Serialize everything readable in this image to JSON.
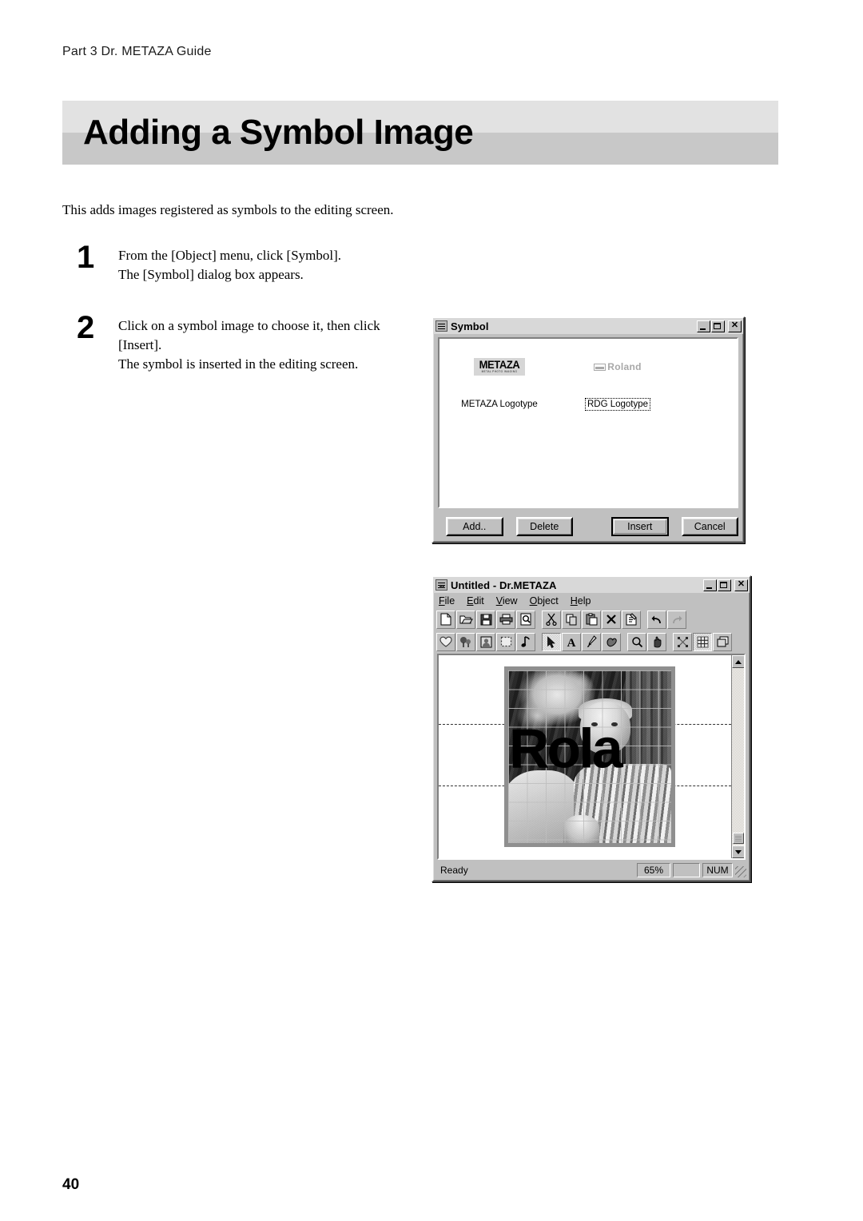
{
  "page": {
    "running_header": "Part 3  Dr. METAZA Guide",
    "title": "Adding a Symbol Image",
    "intro": "This adds images registered as symbols to the editing screen.",
    "page_number": "40"
  },
  "steps": [
    {
      "number": "1",
      "lines": [
        "From the [Object] menu, click [Symbol].",
        "The [Symbol] dialog box appears."
      ]
    },
    {
      "number": "2",
      "lines": [
        "Click on a symbol image to choose it, then click",
        "[Insert].",
        "The symbol is inserted in the editing screen."
      ]
    }
  ],
  "symbol_dialog": {
    "title": "Symbol",
    "window_controls": {
      "minimize": "_",
      "maximize": "□",
      "close": "×"
    },
    "items": [
      {
        "label": "METAZA Logotype",
        "logo_main": "METAZA",
        "logo_sub": "METAL PHOTO IMAGING",
        "selected": false
      },
      {
        "label": "RDG Logotype",
        "logo_text": "Roland",
        "selected": true
      }
    ],
    "buttons": [
      {
        "id": "add",
        "label": "Add..",
        "accel": "A",
        "default": false
      },
      {
        "id": "delete",
        "label": "Delete",
        "accel": "D",
        "default": false
      },
      {
        "id": "insert",
        "label": "Insert",
        "accel": "",
        "default": true
      },
      {
        "id": "cancel",
        "label": "Cancel",
        "accel": "",
        "default": false
      }
    ]
  },
  "metaza_window": {
    "title": "Untitled - Dr.METAZA",
    "window_controls": {
      "minimize": "_",
      "maximize": "□",
      "close": "×"
    },
    "menu": [
      {
        "label": "File",
        "accel": "F"
      },
      {
        "label": "Edit",
        "accel": "E"
      },
      {
        "label": "View",
        "accel": "V"
      },
      {
        "label": "Object",
        "accel": "O"
      },
      {
        "label": "Help",
        "accel": "H"
      }
    ],
    "standard_toolbar": [
      {
        "name": "new-file-icon"
      },
      {
        "name": "open-folder-icon"
      },
      {
        "name": "save-disk-icon"
      },
      {
        "name": "print-icon"
      },
      {
        "name": "print-preview-icon"
      },
      {
        "name": "cut-scissors-icon"
      },
      {
        "name": "copy-icon"
      },
      {
        "name": "paste-icon"
      },
      {
        "name": "delete-x-icon"
      },
      {
        "name": "properties-icon"
      },
      {
        "name": "undo-arrow-icon"
      },
      {
        "name": "redo-arrow-icon"
      }
    ],
    "object_toolbar": [
      {
        "name": "symbol-heart-icon",
        "active": false
      },
      {
        "name": "scene-trees-icon",
        "active": false
      },
      {
        "name": "portrait-photo-icon",
        "active": false
      },
      {
        "name": "marquee-select-icon",
        "active": false
      },
      {
        "name": "music-note-icon",
        "active": false
      },
      {
        "name": "arrow-select-tool-icon",
        "active": true
      },
      {
        "name": "text-tool-icon",
        "active": false
      },
      {
        "name": "pen-tool-icon",
        "active": false
      },
      {
        "name": "shape-tool-icon",
        "active": false
      },
      {
        "name": "zoom-tool-icon",
        "active": false
      },
      {
        "name": "pan-hand-tool-icon",
        "active": false
      },
      {
        "name": "transform-tool-icon",
        "active": false
      },
      {
        "name": "grid-toggle-icon",
        "active": true
      },
      {
        "name": "layers-icon",
        "active": false
      }
    ],
    "canvas": {
      "artwork_text": "Rola",
      "grid_visible": true,
      "guides_visible": true
    },
    "statusbar": {
      "message": "Ready",
      "zoom": "65%",
      "blank": "",
      "num_lock": "NUM"
    }
  }
}
